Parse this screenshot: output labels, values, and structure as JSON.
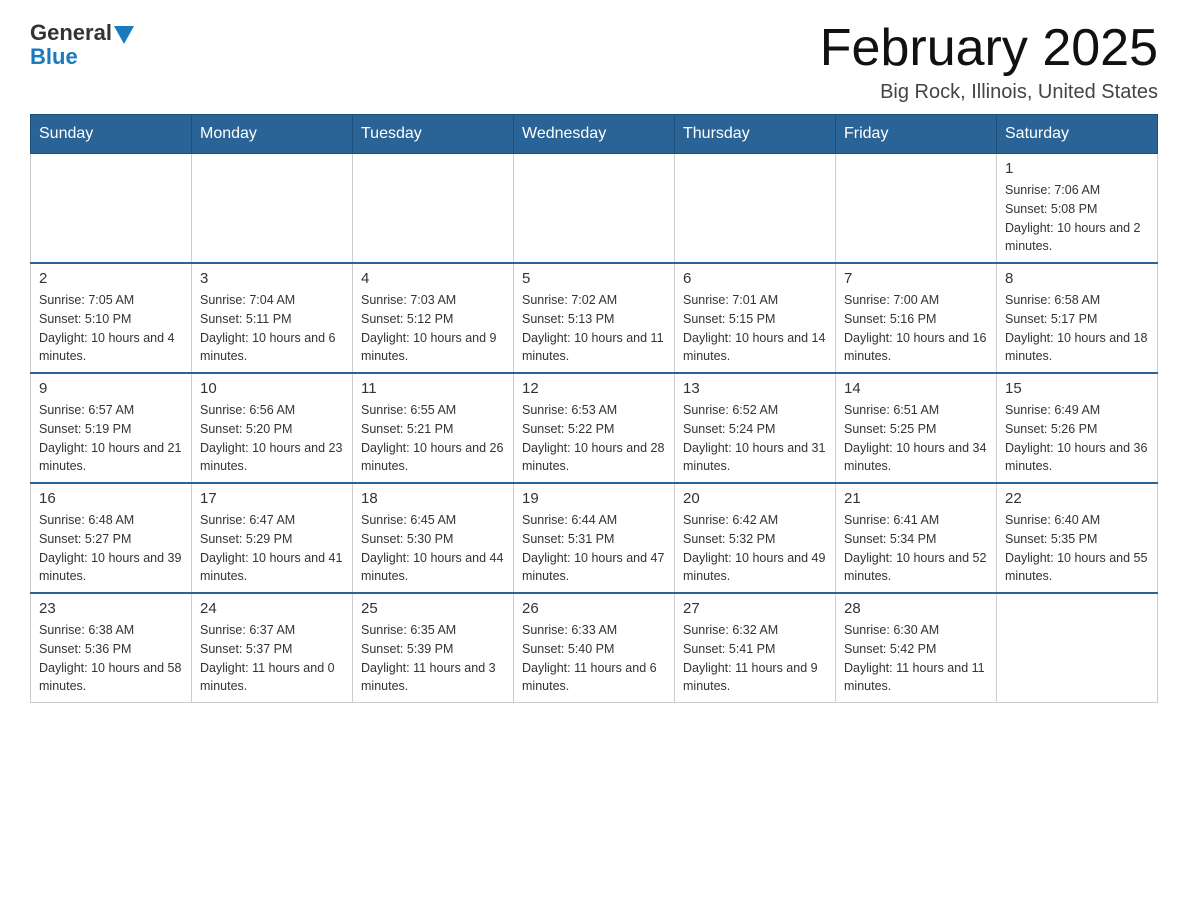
{
  "header": {
    "logo_general": "General",
    "logo_blue": "Blue",
    "title": "February 2025",
    "location": "Big Rock, Illinois, United States"
  },
  "days_of_week": [
    "Sunday",
    "Monday",
    "Tuesday",
    "Wednesday",
    "Thursday",
    "Friday",
    "Saturday"
  ],
  "weeks": [
    [
      {
        "day": "",
        "info": ""
      },
      {
        "day": "",
        "info": ""
      },
      {
        "day": "",
        "info": ""
      },
      {
        "day": "",
        "info": ""
      },
      {
        "day": "",
        "info": ""
      },
      {
        "day": "",
        "info": ""
      },
      {
        "day": "1",
        "info": "Sunrise: 7:06 AM\nSunset: 5:08 PM\nDaylight: 10 hours and 2 minutes."
      }
    ],
    [
      {
        "day": "2",
        "info": "Sunrise: 7:05 AM\nSunset: 5:10 PM\nDaylight: 10 hours and 4 minutes."
      },
      {
        "day": "3",
        "info": "Sunrise: 7:04 AM\nSunset: 5:11 PM\nDaylight: 10 hours and 6 minutes."
      },
      {
        "day": "4",
        "info": "Sunrise: 7:03 AM\nSunset: 5:12 PM\nDaylight: 10 hours and 9 minutes."
      },
      {
        "day": "5",
        "info": "Sunrise: 7:02 AM\nSunset: 5:13 PM\nDaylight: 10 hours and 11 minutes."
      },
      {
        "day": "6",
        "info": "Sunrise: 7:01 AM\nSunset: 5:15 PM\nDaylight: 10 hours and 14 minutes."
      },
      {
        "day": "7",
        "info": "Sunrise: 7:00 AM\nSunset: 5:16 PM\nDaylight: 10 hours and 16 minutes."
      },
      {
        "day": "8",
        "info": "Sunrise: 6:58 AM\nSunset: 5:17 PM\nDaylight: 10 hours and 18 minutes."
      }
    ],
    [
      {
        "day": "9",
        "info": "Sunrise: 6:57 AM\nSunset: 5:19 PM\nDaylight: 10 hours and 21 minutes."
      },
      {
        "day": "10",
        "info": "Sunrise: 6:56 AM\nSunset: 5:20 PM\nDaylight: 10 hours and 23 minutes."
      },
      {
        "day": "11",
        "info": "Sunrise: 6:55 AM\nSunset: 5:21 PM\nDaylight: 10 hours and 26 minutes."
      },
      {
        "day": "12",
        "info": "Sunrise: 6:53 AM\nSunset: 5:22 PM\nDaylight: 10 hours and 28 minutes."
      },
      {
        "day": "13",
        "info": "Sunrise: 6:52 AM\nSunset: 5:24 PM\nDaylight: 10 hours and 31 minutes."
      },
      {
        "day": "14",
        "info": "Sunrise: 6:51 AM\nSunset: 5:25 PM\nDaylight: 10 hours and 34 minutes."
      },
      {
        "day": "15",
        "info": "Sunrise: 6:49 AM\nSunset: 5:26 PM\nDaylight: 10 hours and 36 minutes."
      }
    ],
    [
      {
        "day": "16",
        "info": "Sunrise: 6:48 AM\nSunset: 5:27 PM\nDaylight: 10 hours and 39 minutes."
      },
      {
        "day": "17",
        "info": "Sunrise: 6:47 AM\nSunset: 5:29 PM\nDaylight: 10 hours and 41 minutes."
      },
      {
        "day": "18",
        "info": "Sunrise: 6:45 AM\nSunset: 5:30 PM\nDaylight: 10 hours and 44 minutes."
      },
      {
        "day": "19",
        "info": "Sunrise: 6:44 AM\nSunset: 5:31 PM\nDaylight: 10 hours and 47 minutes."
      },
      {
        "day": "20",
        "info": "Sunrise: 6:42 AM\nSunset: 5:32 PM\nDaylight: 10 hours and 49 minutes."
      },
      {
        "day": "21",
        "info": "Sunrise: 6:41 AM\nSunset: 5:34 PM\nDaylight: 10 hours and 52 minutes."
      },
      {
        "day": "22",
        "info": "Sunrise: 6:40 AM\nSunset: 5:35 PM\nDaylight: 10 hours and 55 minutes."
      }
    ],
    [
      {
        "day": "23",
        "info": "Sunrise: 6:38 AM\nSunset: 5:36 PM\nDaylight: 10 hours and 58 minutes."
      },
      {
        "day": "24",
        "info": "Sunrise: 6:37 AM\nSunset: 5:37 PM\nDaylight: 11 hours and 0 minutes."
      },
      {
        "day": "25",
        "info": "Sunrise: 6:35 AM\nSunset: 5:39 PM\nDaylight: 11 hours and 3 minutes."
      },
      {
        "day": "26",
        "info": "Sunrise: 6:33 AM\nSunset: 5:40 PM\nDaylight: 11 hours and 6 minutes."
      },
      {
        "day": "27",
        "info": "Sunrise: 6:32 AM\nSunset: 5:41 PM\nDaylight: 11 hours and 9 minutes."
      },
      {
        "day": "28",
        "info": "Sunrise: 6:30 AM\nSunset: 5:42 PM\nDaylight: 11 hours and 11 minutes."
      },
      {
        "day": "",
        "info": ""
      }
    ]
  ]
}
